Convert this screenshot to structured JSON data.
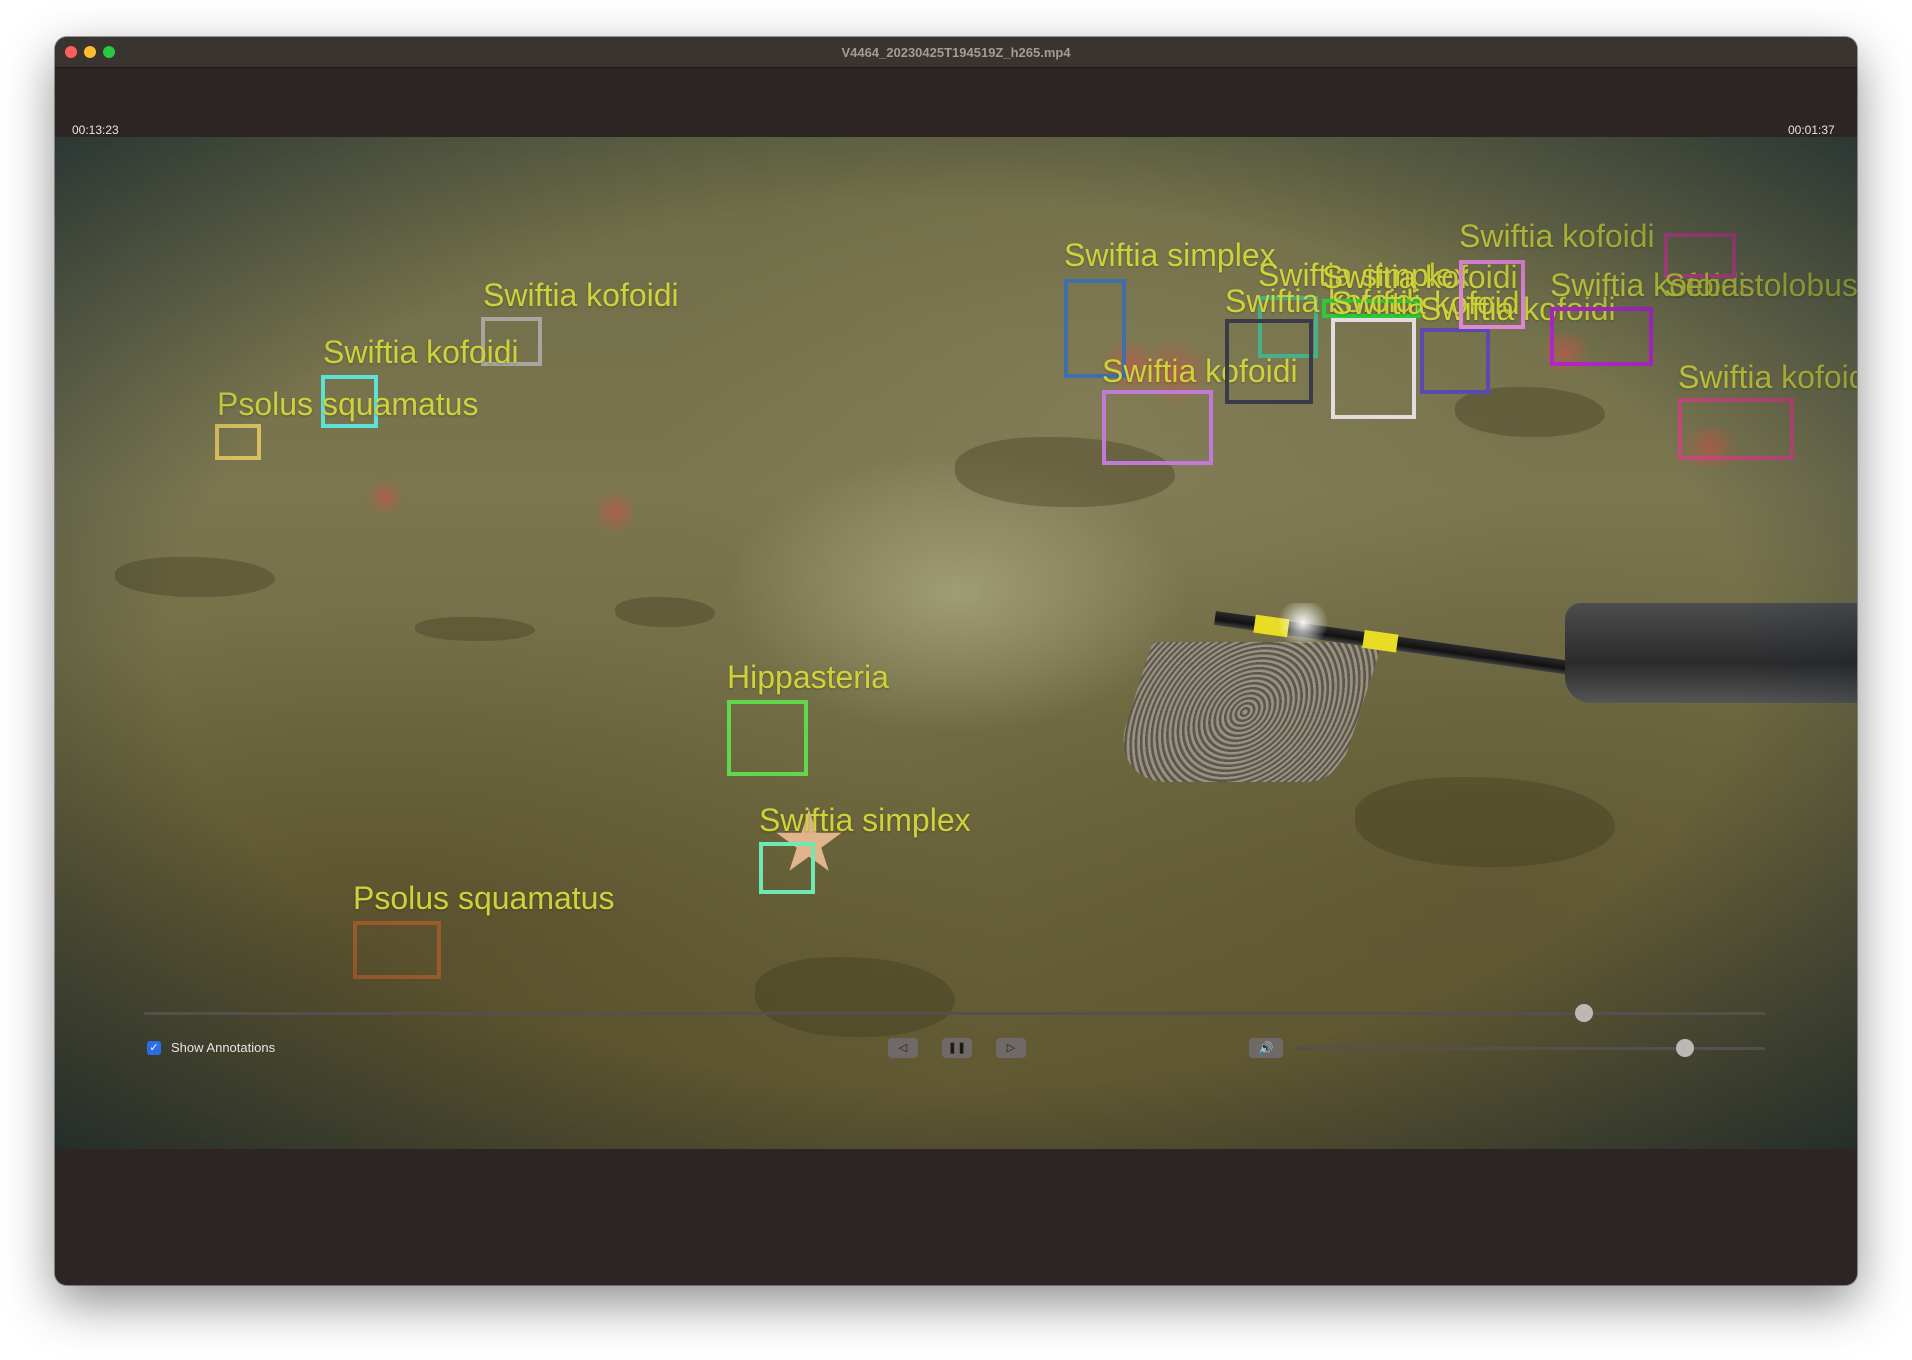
{
  "window": {
    "title": "V4464_20230425T194519Z_h265.mp4"
  },
  "annotations": [
    {
      "label": "Swiftia simplex",
      "color": "#3f6ea8"
    },
    {
      "label": "Swiftia kofoidi",
      "color": "#a8a4a0"
    },
    {
      "label": "Swiftia kofoidi",
      "color": "#5fe0d6"
    },
    {
      "label": "Psolus squamatus",
      "color": "#d8c060"
    },
    {
      "label": "Swiftia kofoidi",
      "color": "#c07ad8"
    },
    {
      "label": "Swiftia simplex",
      "color": "#46b08a"
    },
    {
      "label": "Swiftia kofoidi",
      "color": "#3a3a48"
    },
    {
      "label": "Swiftia kofoidi",
      "color": "#2ec83a"
    },
    {
      "label": "Swiftia kofoidi",
      "color": "#e2dcdc"
    },
    {
      "label": "Swiftia kofoidi",
      "color": "#5a4ab0"
    },
    {
      "label": "Swiftia kofoidi",
      "color": "#e087d8"
    },
    {
      "label": "Swiftia kofoidi",
      "color": "#b026c6"
    },
    {
      "label": "Sebastolobus",
      "color": "#c8488a"
    },
    {
      "label": "Swiftia kofoidi",
      "color": "#c84a78"
    },
    {
      "label": "Hippasteria",
      "color": "#62d64c"
    },
    {
      "label": "Swiftia simplex",
      "color": "#6ee8b4"
    },
    {
      "label": "Psolus squamatus",
      "color": "#9a5a2a"
    }
  ],
  "controls": {
    "elapsed_time": "00:13:23",
    "remaining_time": "00:01:37",
    "progress_fraction": 0.888,
    "volume_fraction": 0.83,
    "show_annotations_label": "Show Annotations",
    "show_annotations_checked": true,
    "checkbox_glyph": "✓",
    "back_icon": "skip-back-icon",
    "play_pause_icon": "pause-icon",
    "forward_icon": "skip-forward-icon",
    "volume_icon": "speaker-icon",
    "back_glyph": "◁",
    "pause_glyph": "❚❚",
    "forward_glyph": "▷",
    "volume_glyph": "🔊"
  }
}
